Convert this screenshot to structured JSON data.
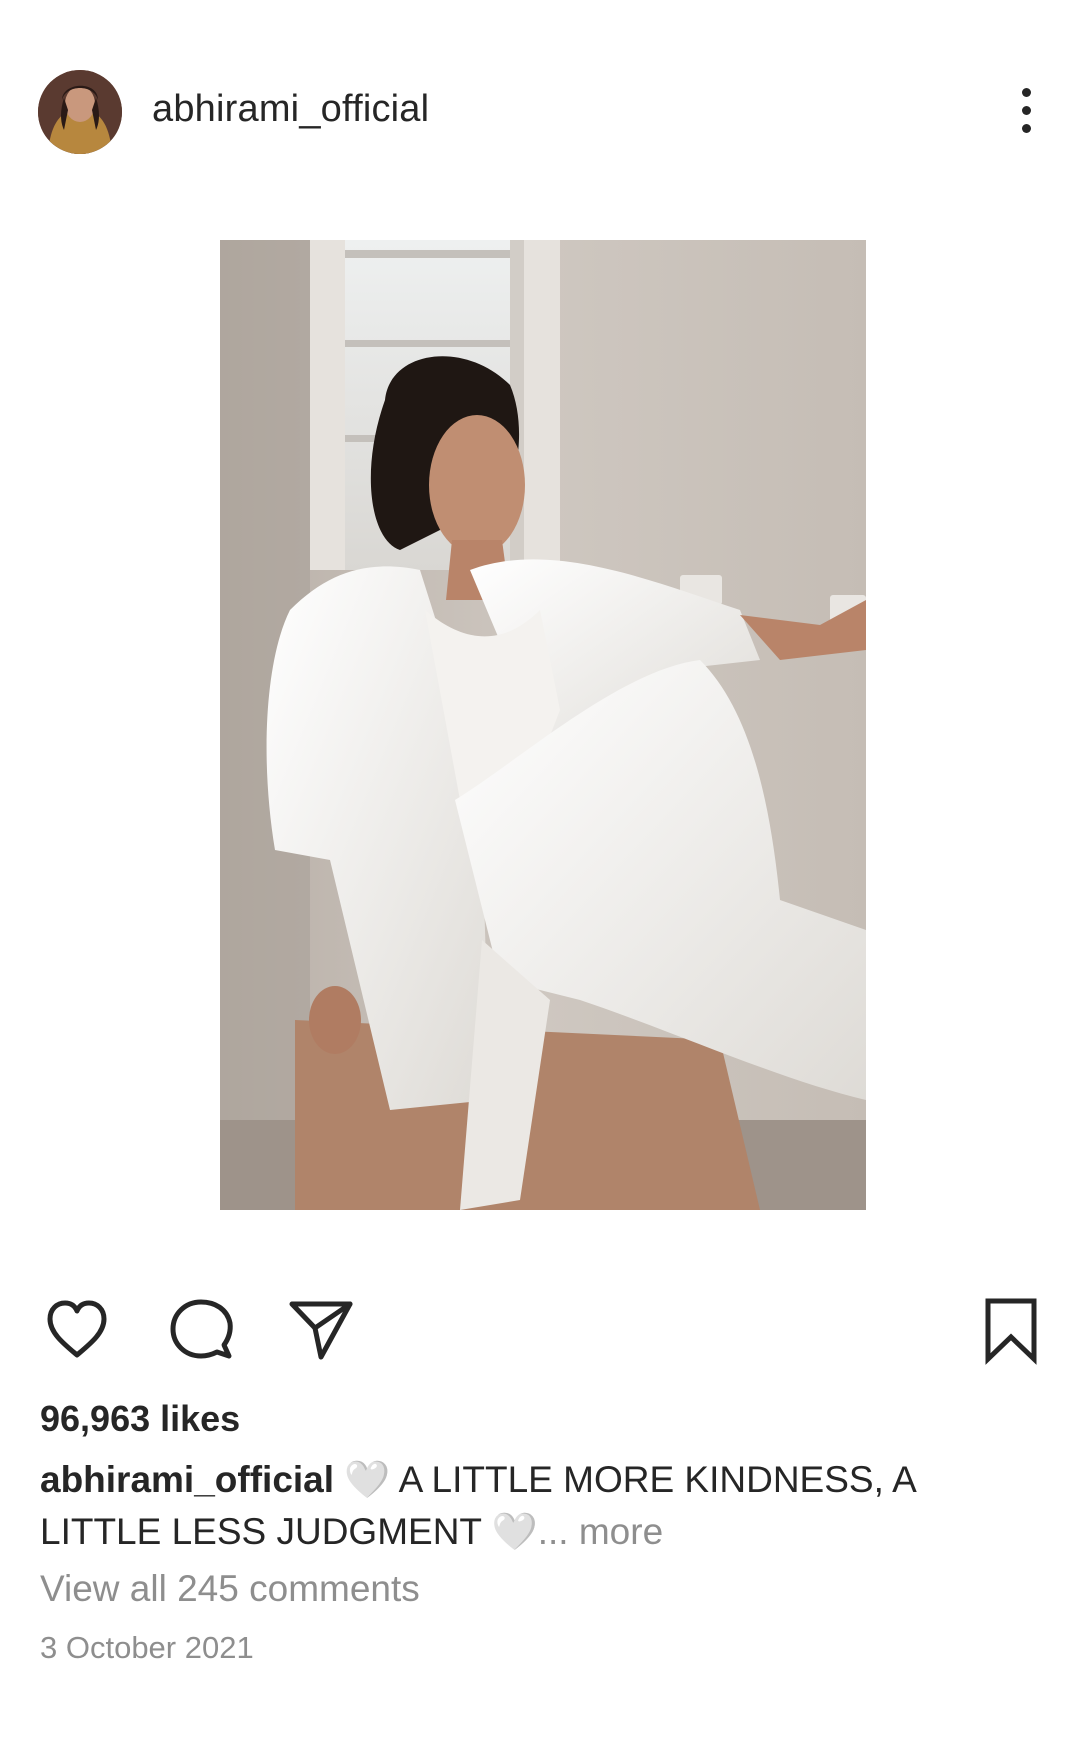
{
  "post": {
    "username": "abhirami_official",
    "likes": "96,963 likes",
    "caption": {
      "username": "abhirami_official",
      "heart1": "🤍",
      "text1": " A LITTLE MORE KINDNESS, A LITTLE LESS JUDGMENT ",
      "heart2": "🤍",
      "more": "... more"
    },
    "view_comments": "View all 245 comments",
    "date": "3 October 2021"
  },
  "icons": {
    "more": "more-options-icon",
    "like": "heart-icon",
    "comment": "comment-icon",
    "share": "share-icon",
    "save": "bookmark-icon"
  },
  "colors": {
    "text": "#262626",
    "secondary_text": "#8e8e8e",
    "background": "#ffffff",
    "outfit": "#f2f1ee",
    "wall": "#c9c2bb"
  }
}
